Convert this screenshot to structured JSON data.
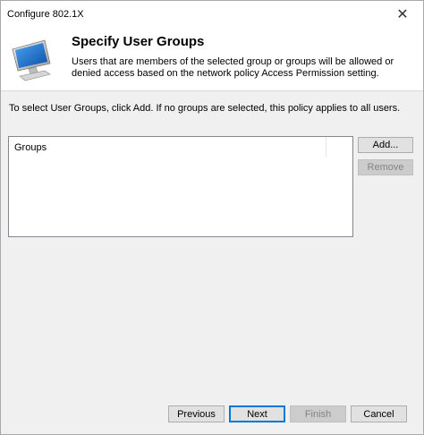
{
  "window": {
    "title": "Configure 802.1X",
    "close_glyph": "✕"
  },
  "header": {
    "icon": "computer-monitor-icon",
    "title": "Specify User Groups",
    "description": "Users that are members of the selected group or groups will be allowed or denied access based on the network policy Access Permission setting."
  },
  "main": {
    "instruction": "To select User Groups, click Add. If no groups are selected, this policy applies to all users.",
    "groups_list": {
      "column_header": "Groups",
      "rows": []
    },
    "add_label": "Add...",
    "remove_label": "Remove"
  },
  "footer": {
    "previous_label": "Previous",
    "next_label": "Next",
    "finish_label": "Finish",
    "cancel_label": "Cancel"
  },
  "colors": {
    "accent": "#0078d7",
    "dialog_bg": "#f0f0f0",
    "disabled_text": "#838383"
  }
}
